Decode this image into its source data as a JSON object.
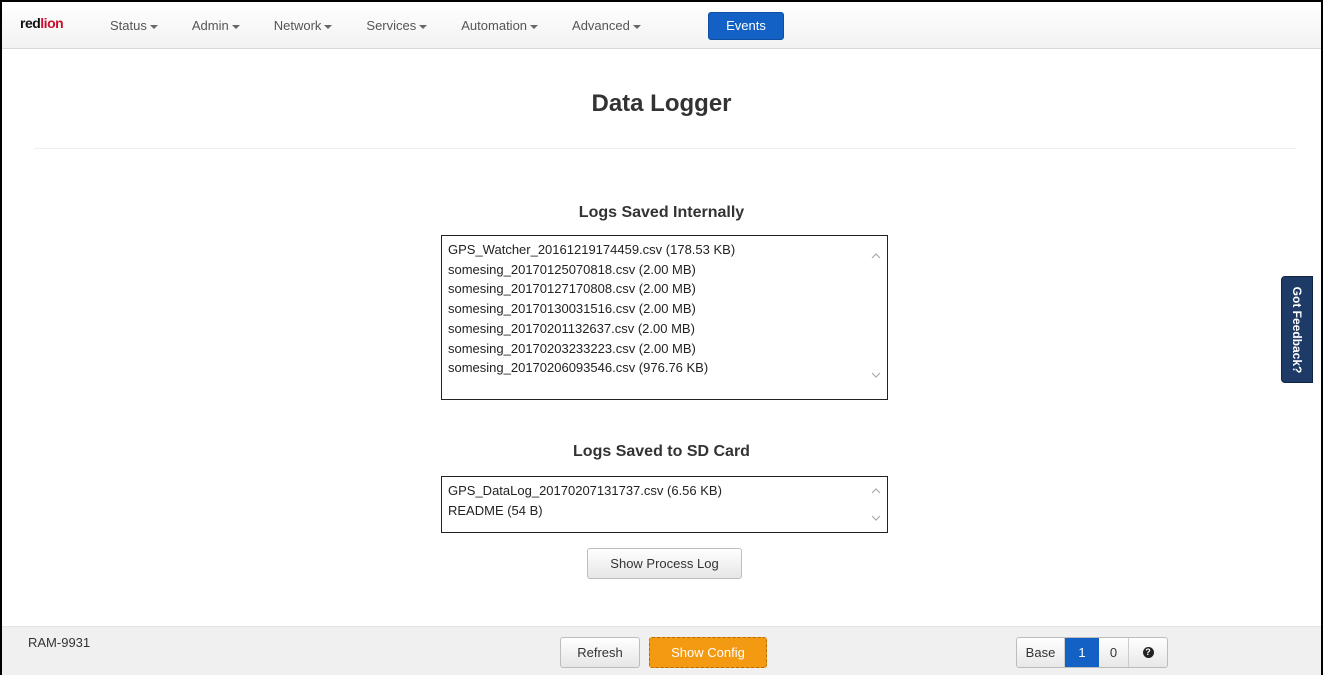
{
  "navbar": {
    "logo": {
      "red": "red",
      "lion": "lion"
    },
    "items": [
      {
        "label": "Status"
      },
      {
        "label": "Admin"
      },
      {
        "label": "Network"
      },
      {
        "label": "Services"
      },
      {
        "label": "Automation"
      },
      {
        "label": "Advanced"
      }
    ],
    "active_item": "Events"
  },
  "page": {
    "title": "Data Logger"
  },
  "internal_logs": {
    "title": "Logs Saved Internally",
    "files": [
      "GPS_Watcher_20161219174459.csv (178.53 KB)",
      "somesing_20170125070818.csv (2.00 MB)",
      "somesing_20170127170808.csv (2.00 MB)",
      "somesing_20170130031516.csv (2.00 MB)",
      "somesing_20170201132637.csv (2.00 MB)",
      "somesing_20170203233223.csv (2.00 MB)",
      "somesing_20170206093546.csv (976.76 KB)"
    ]
  },
  "sd_logs": {
    "title": "Logs Saved to SD Card",
    "files": [
      "GPS_DataLog_20170207131737.csv (6.56 KB)",
      "README (54 B)"
    ]
  },
  "buttons": {
    "show_process_log": "Show Process Log",
    "refresh": "Refresh",
    "show_config": "Show Config"
  },
  "feedback_tab": "Got Feedback?",
  "footer": {
    "device_name": "RAM-9931",
    "base_label": "Base",
    "base_selected": "1",
    "base_other": "0",
    "help_glyph": "?"
  },
  "colors": {
    "primary_blue": "#1361c4",
    "warning_orange": "#f39a12",
    "feedback_navy": "#1e3a66",
    "logo_red": "#c8102e"
  }
}
